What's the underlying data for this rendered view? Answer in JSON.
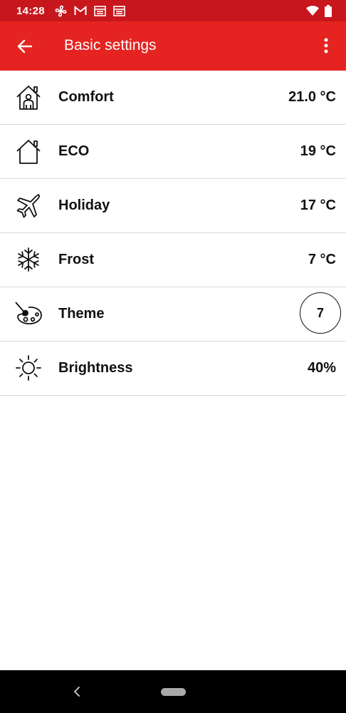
{
  "status_bar": {
    "time": "14:28",
    "icons_left": [
      "fan-icon",
      "gmail-icon",
      "news-icon",
      "news-icon"
    ],
    "icons_right": [
      "wifi-icon",
      "battery-icon"
    ]
  },
  "app_bar": {
    "title": "Basic settings",
    "back_icon": "arrow-left-icon",
    "menu_icon": "more-vertical-icon",
    "background": "#e52421"
  },
  "settings": [
    {
      "icon": "house-person-icon",
      "label": "Comfort",
      "value": "21.0 °C"
    },
    {
      "icon": "house-icon",
      "label": "ECO",
      "value": "19 °C"
    },
    {
      "icon": "airplane-icon",
      "label": "Holiday",
      "value": "17 °C"
    },
    {
      "icon": "snowflake-icon",
      "label": "Frost",
      "value": "7 °C"
    },
    {
      "icon": "palette-icon",
      "label": "Theme",
      "value": "7"
    },
    {
      "icon": "sun-icon",
      "label": "Brightness",
      "value": "40%"
    }
  ],
  "nav_bar": {
    "back_icon": "chevron-left-icon",
    "home_icon": "home-pill-icon"
  }
}
